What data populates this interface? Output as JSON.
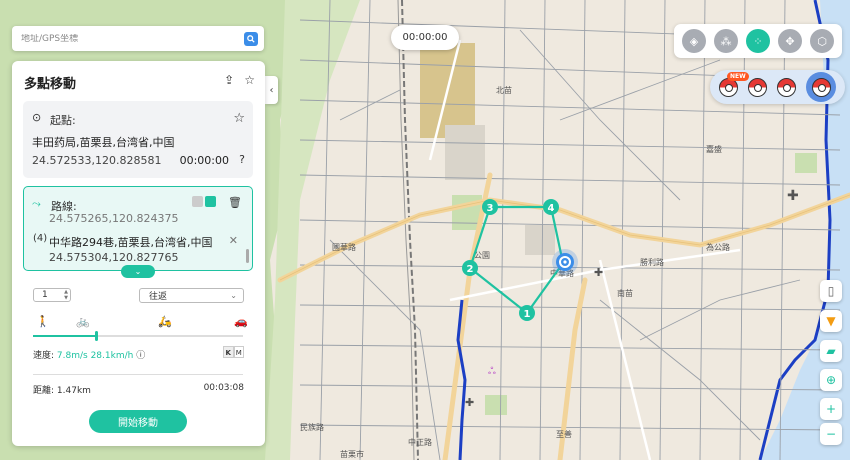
{
  "map": {
    "labels": {
      "north_district": "北苗",
      "east_district": "嘉盛",
      "south_district": "南苗",
      "west_district": "公園",
      "road_east": "為公路",
      "road_west": "國華路",
      "road_sw": "民族路",
      "road_south": "中正路",
      "road_ne": "勝利路",
      "road_main": "中華路",
      "district_bottom": "苗栗市",
      "district_mid": "至善"
    },
    "waypoints": [
      "1",
      "2",
      "3",
      "4"
    ],
    "timer": "00:00:00",
    "new_badge": "NEW"
  },
  "search": {
    "placeholder": "地址/GPS坐標"
  },
  "panel": {
    "title": "多點移動",
    "start": {
      "label": "起點:",
      "address": "丰田药局,苗栗县,台湾省,中国",
      "coords": "24.572533,120.828581",
      "time": "00:00:00"
    },
    "route": {
      "label": "路線:",
      "prev_coords": "24.575265,120.824375",
      "stop_index": "4",
      "stop_address": "中华路294巷,苗栗县,台湾省,中国",
      "stop_coords": "24.575304,120.827765"
    },
    "repeat_count": "1",
    "repeat_mode": "往返",
    "speed_label": "速度:",
    "speed_value": "7.8m/s 28.1km/h",
    "speed_level": 0.3,
    "unit_k": "K",
    "unit_m": "M",
    "distance_label": "距離:",
    "distance_value": "1.47km",
    "duration": "00:03:08",
    "start_button": "開始移動"
  },
  "colors": {
    "accent": "#1fc2a1",
    "route": "#1fc2a1",
    "river": "#1c3fc4",
    "location": "#3b8de8"
  }
}
